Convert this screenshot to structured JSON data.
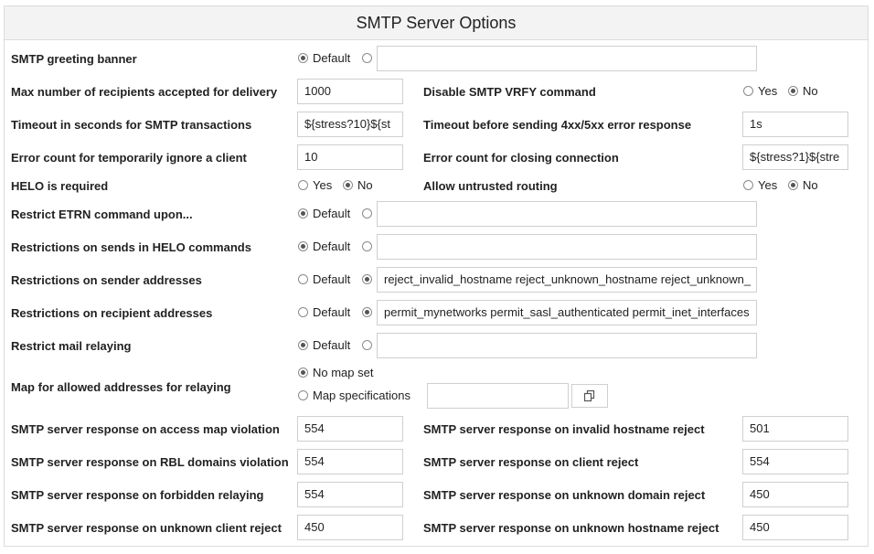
{
  "title": "SMTP Server Options",
  "radio_labels": {
    "default": "Default",
    "yes": "Yes",
    "no": "No",
    "no_map": "No map set",
    "map_spec": "Map specifications"
  },
  "rows": {
    "greeting_banner": {
      "label": "SMTP greeting banner",
      "selected": "default",
      "value": ""
    },
    "max_recipients": {
      "label": "Max number of recipients accepted for delivery",
      "value": "1000"
    },
    "disable_vrfy": {
      "label": "Disable SMTP VRFY command",
      "selected": "no"
    },
    "timeout_smtp": {
      "label": "Timeout in seconds for SMTP transactions",
      "value": "${stress?10}${st"
    },
    "timeout_error": {
      "label": "Timeout before sending 4xx/5xx error response",
      "value": "1s"
    },
    "error_count_ignore": {
      "label": "Error count for temporarily ignore a client",
      "value": "10"
    },
    "error_count_close": {
      "label": "Error count for closing connection",
      "value": "${stress?1}${stre"
    },
    "helo_required": {
      "label": "HELO is required",
      "selected": "no"
    },
    "untrusted_routing": {
      "label": "Allow untrusted routing",
      "selected": "no"
    },
    "restrict_etrn": {
      "label": "Restrict ETRN command upon...",
      "selected": "default",
      "value": ""
    },
    "restrict_helo": {
      "label": "Restrictions on sends in HELO commands",
      "selected": "default",
      "value": ""
    },
    "restrict_sender": {
      "label": "Restrictions on sender addresses",
      "selected": "custom",
      "value": "reject_invalid_hostname reject_unknown_hostname reject_unknown_"
    },
    "restrict_recipient": {
      "label": "Restrictions on recipient addresses",
      "selected": "custom",
      "value": "permit_mynetworks permit_sasl_authenticated permit_inet_interfaces"
    },
    "restrict_relaying": {
      "label": "Restrict mail relaying",
      "selected": "default",
      "value": ""
    },
    "relay_map": {
      "label": "Map for allowed addresses for relaying",
      "selected": "no_map",
      "value": ""
    },
    "resp_access_map": {
      "label": "SMTP server response on access map violation",
      "value": "554"
    },
    "resp_invalid_hostname": {
      "label": "SMTP server response on invalid hostname reject",
      "value": "501"
    },
    "resp_rbl": {
      "label": "SMTP server response on RBL domains violation",
      "value": "554"
    },
    "resp_client_reject": {
      "label": "SMTP server response on client reject",
      "value": "554"
    },
    "resp_forbidden_relay": {
      "label": "SMTP server response on forbidden relaying",
      "value": "554"
    },
    "resp_unknown_domain": {
      "label": "SMTP server response on unknown domain reject",
      "value": "450"
    },
    "resp_unknown_client": {
      "label": "SMTP server response on unknown client reject",
      "value": "450"
    },
    "resp_unknown_hostname": {
      "label": "SMTP server response on unknown hostname reject",
      "value": "450"
    }
  },
  "icons": {
    "map_chooser": "copy-icon"
  }
}
